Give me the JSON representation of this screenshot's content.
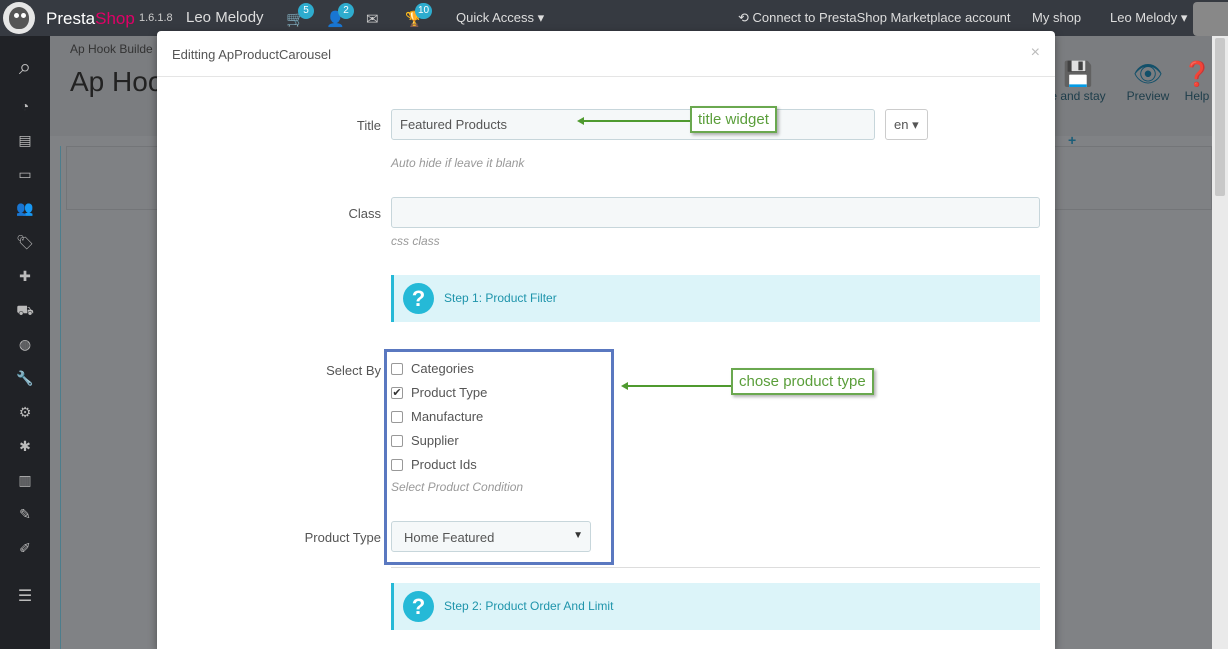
{
  "topbar": {
    "brand_presta": "Presta",
    "brand_shop": "Shop",
    "version": "1.6.1.8",
    "user_title": "Leo Melody",
    "orders_badge": "5",
    "customers_badge": "2",
    "trophy_badge": "10",
    "quick_access": "Quick Access",
    "marketplace": "Connect to PrestaShop Marketplace account",
    "my_shop": "My shop",
    "user_menu": "Leo Melody"
  },
  "background": {
    "breadcrumb": "Ap Hook Builde",
    "title": "Ap Hoo",
    "tool_save": "e and stay",
    "tool_preview": "Preview",
    "tool_help": "Help"
  },
  "modal": {
    "title": "Editting ApProductCarousel",
    "close": "×",
    "fields": {
      "title_label": "Title",
      "title_value": "Featured Products",
      "lang": "en",
      "title_help": "Auto hide if leave it blank",
      "class_label": "Class",
      "class_value": "",
      "class_help": "css class",
      "step1": "Step 1: Product Filter",
      "select_by_label": "Select By",
      "options": [
        {
          "label": "Categories",
          "checked": false
        },
        {
          "label": "Product Type",
          "checked": true
        },
        {
          "label": "Manufacture",
          "checked": false
        },
        {
          "label": "Supplier",
          "checked": false
        },
        {
          "label": "Product Ids",
          "checked": false
        }
      ],
      "condition_help": "Select Product Condition",
      "product_type_label": "Product Type",
      "product_type_value": "Home Featured",
      "step2": "Step 2: Product Order And Limit"
    }
  },
  "annotations": {
    "title_widget": "title widget",
    "chose_product_type": "chose product type"
  },
  "colors": {
    "topbar": "#363a41",
    "sidebar": "#202226",
    "accent": "#25b9d7",
    "annotation_green": "#6aa84f",
    "annotation_blue": "#5a78c0"
  }
}
